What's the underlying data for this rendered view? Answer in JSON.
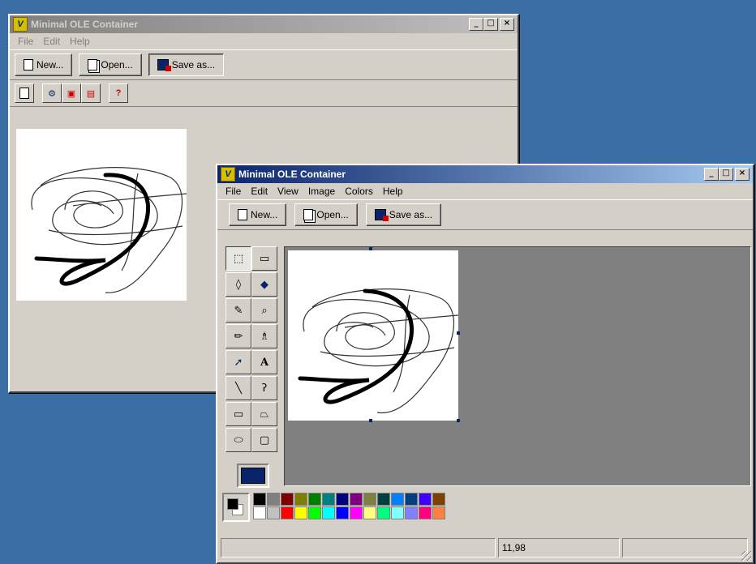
{
  "back_window": {
    "title": "Minimal OLE Container",
    "menu": [
      "File",
      "Edit",
      "Help"
    ],
    "buttons": {
      "new": "New...",
      "open": "Open...",
      "save_as": "Save as..."
    },
    "caption": {
      "minimize": "_",
      "maximize": "□",
      "close": "×"
    }
  },
  "front_window": {
    "title": "Minimal OLE Container",
    "menu": [
      "File",
      "Edit",
      "View",
      "Image",
      "Colors",
      "Help"
    ],
    "buttons": {
      "new": "New...",
      "open": "Open...",
      "save_as": "Save as..."
    },
    "caption": {
      "minimize": "_",
      "maximize": "□",
      "close": "×"
    },
    "tools": [
      {
        "name": "free-select",
        "glyph": "⬚"
      },
      {
        "name": "rect-select",
        "glyph": "▭"
      },
      {
        "name": "eraser",
        "glyph": "◊"
      },
      {
        "name": "fill",
        "glyph": "◆"
      },
      {
        "name": "color-picker",
        "glyph": "✎"
      },
      {
        "name": "magnifier",
        "glyph": "⌕"
      },
      {
        "name": "pencil",
        "glyph": "✏"
      },
      {
        "name": "brush",
        "glyph": "♗"
      },
      {
        "name": "airbrush",
        "glyph": "➚"
      },
      {
        "name": "text",
        "glyph": "A"
      },
      {
        "name": "line",
        "glyph": "╲"
      },
      {
        "name": "curve",
        "glyph": "ʔ"
      },
      {
        "name": "rectangle",
        "glyph": "▭"
      },
      {
        "name": "polygon",
        "glyph": "⏢"
      },
      {
        "name": "ellipse",
        "glyph": "⬭"
      },
      {
        "name": "rounded-rect",
        "glyph": "▢"
      }
    ],
    "palette_top": [
      "#000000",
      "#808080",
      "#800000",
      "#808000",
      "#008000",
      "#008080",
      "#000080",
      "#800080",
      "#808040",
      "#004040",
      "#0080ff",
      "#004080",
      "#4000ff",
      "#804000"
    ],
    "palette_bottom": [
      "#ffffff",
      "#c0c0c0",
      "#ff0000",
      "#ffff00",
      "#00ff00",
      "#00ffff",
      "#0000ff",
      "#ff00ff",
      "#ffff80",
      "#00ff80",
      "#80ffff",
      "#8080ff",
      "#ff0080",
      "#ff8040"
    ],
    "foreground_color": "#000000",
    "background_color": "#ffffff",
    "status": {
      "coords": "11,98"
    }
  },
  "colors": {
    "desktop": "#3a6ea5",
    "active_title": "#0a246a",
    "workspace": "#808080"
  }
}
